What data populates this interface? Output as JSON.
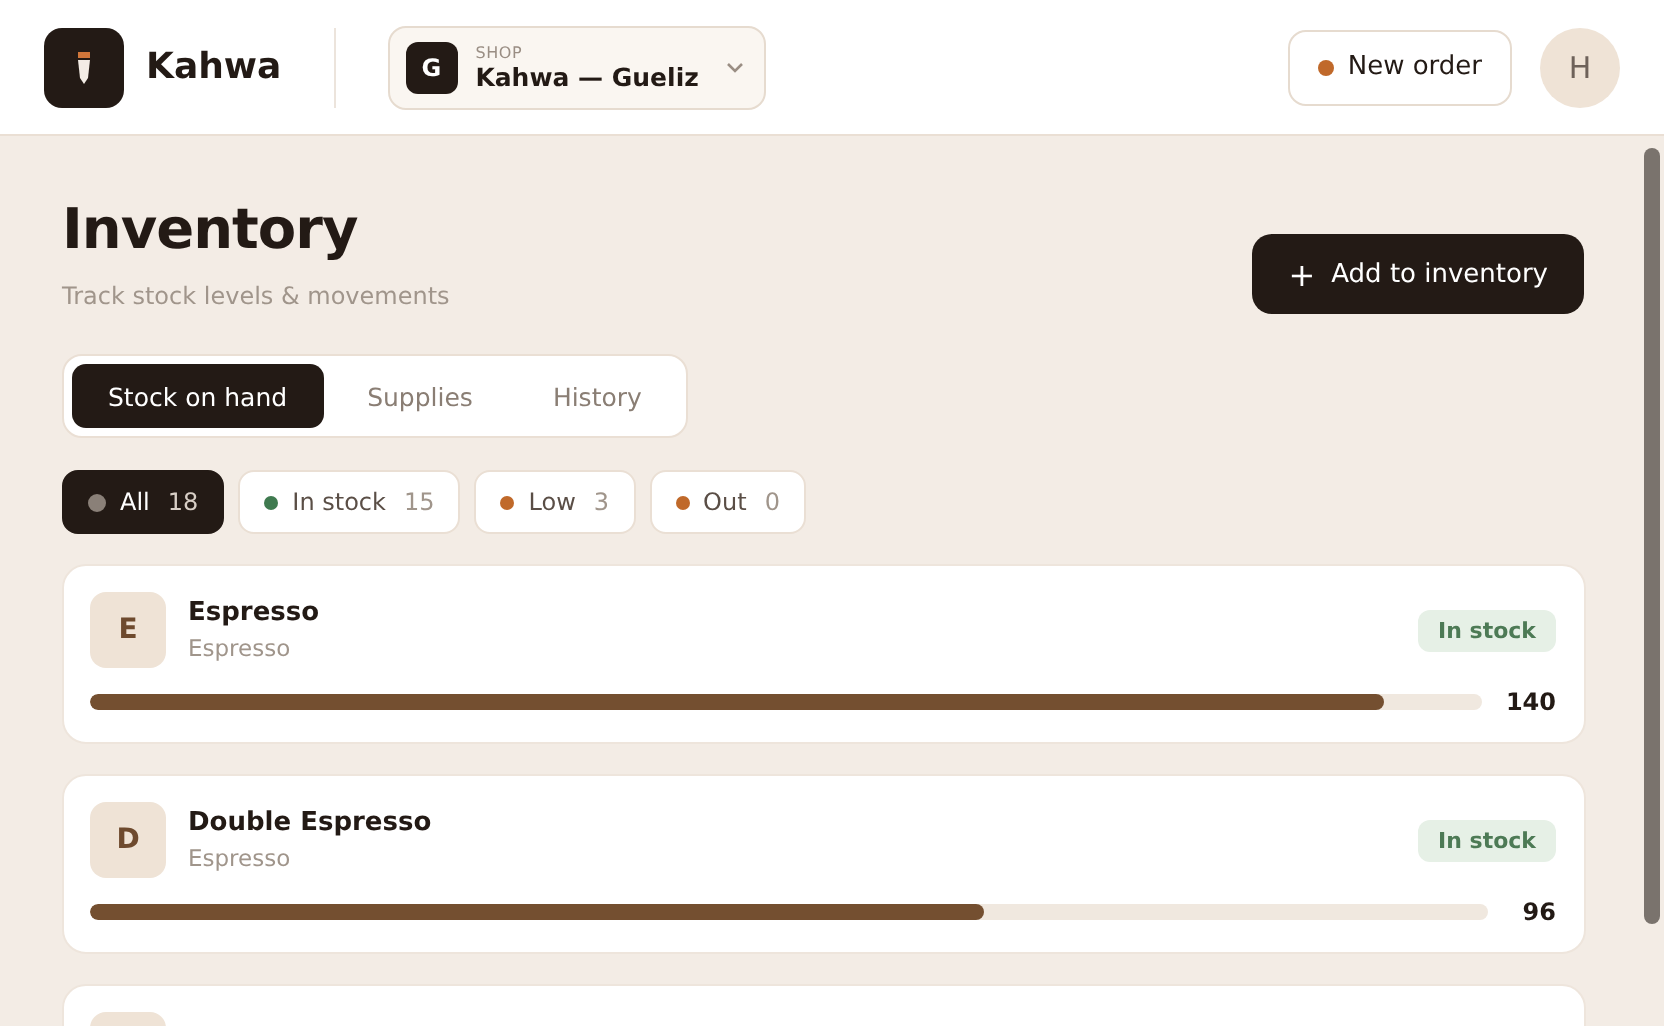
{
  "header": {
    "brand": "Kahwa",
    "shop": {
      "initial": "G",
      "label": "SHOP",
      "name": "Kahwa — Gueliz"
    },
    "new_order": "New order",
    "avatar": "H"
  },
  "page": {
    "title": "Inventory",
    "subtitle": "Track stock levels & movements",
    "add_button": "Add to inventory",
    "add_icon": "+"
  },
  "tabs": [
    {
      "label": "Stock on hand",
      "selected": true
    },
    {
      "label": "Supplies",
      "selected": false
    },
    {
      "label": "History",
      "selected": false
    }
  ],
  "filters": [
    {
      "label": "All",
      "count": "18",
      "selected": true,
      "color": "#8a8078"
    },
    {
      "label": "In stock",
      "count": "15",
      "selected": false,
      "color": "#3f7a4f"
    },
    {
      "label": "Low",
      "count": "3",
      "selected": false,
      "color": "#c0692a"
    },
    {
      "label": "Out",
      "count": "0",
      "selected": false,
      "color": "#c0692a"
    }
  ],
  "items": [
    {
      "initial": "E",
      "name": "Espresso",
      "category": "Espresso",
      "status": "In stock",
      "level": 0.93,
      "quantity": "140"
    },
    {
      "initial": "D",
      "name": "Double Espresso",
      "category": "Espresso",
      "status": "In stock",
      "level": 0.64,
      "quantity": "96"
    }
  ]
}
